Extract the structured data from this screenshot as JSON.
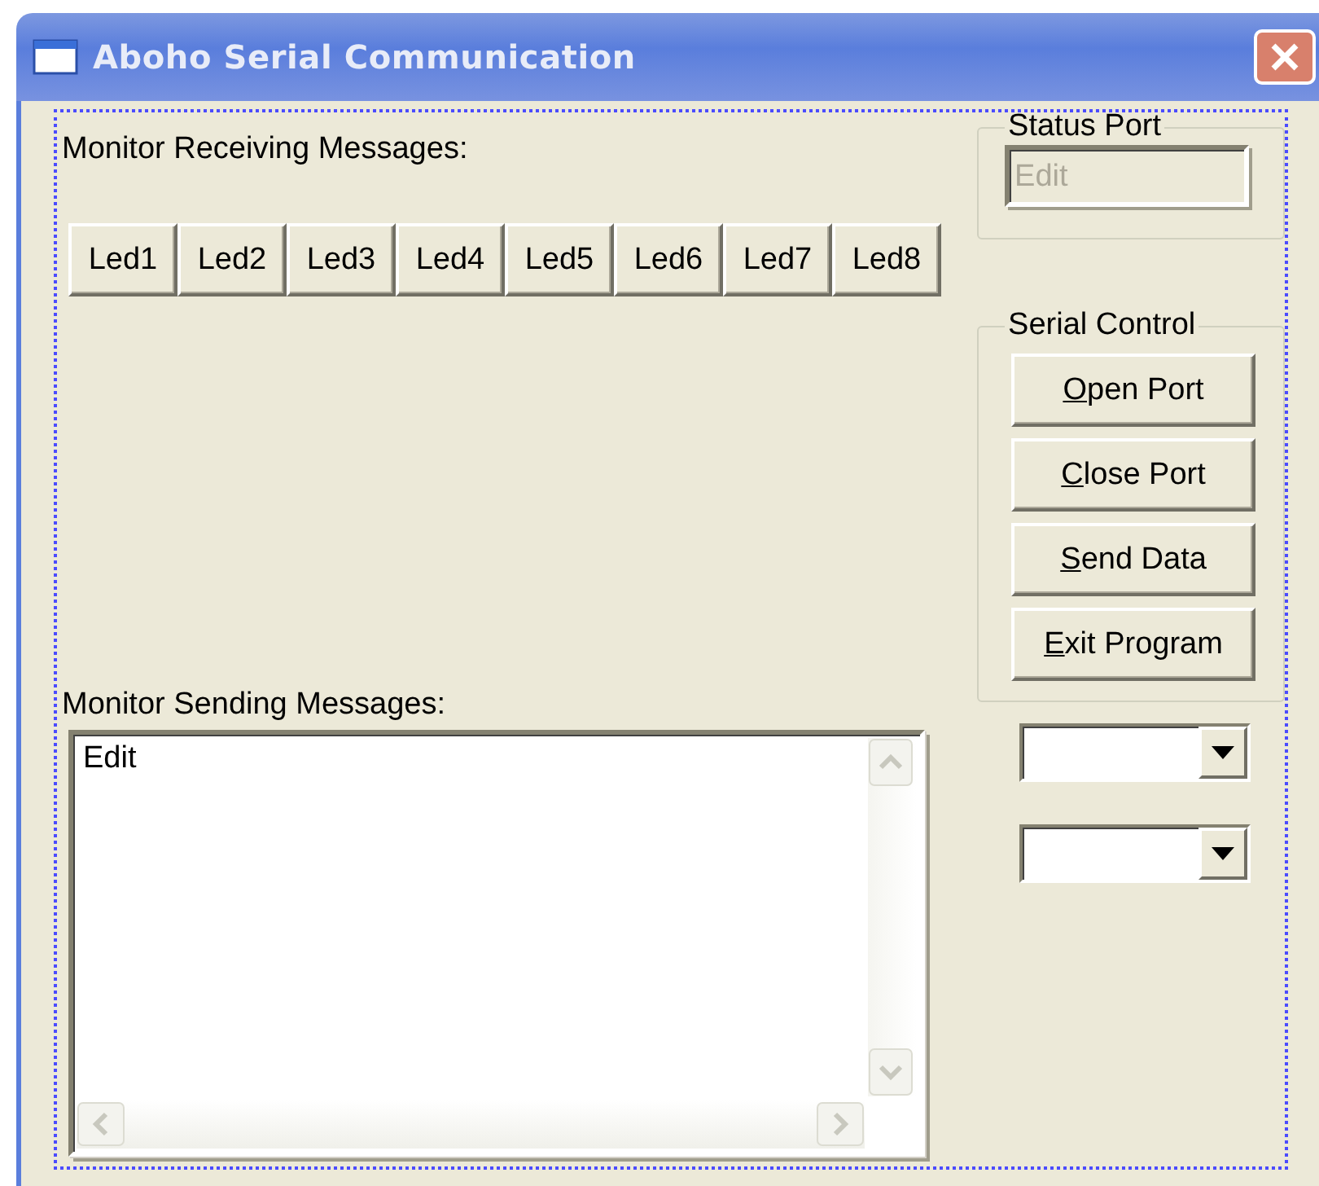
{
  "window": {
    "title": "Aboho Serial Communication"
  },
  "receive": {
    "label": "Monitor Receiving Messages:",
    "leds": [
      "Led1",
      "Led2",
      "Led3",
      "Led4",
      "Led5",
      "Led6",
      "Led7",
      "Led8"
    ]
  },
  "status_port": {
    "title": "Status Port",
    "field": {
      "value": "Edit",
      "disabled": true
    }
  },
  "serial_control": {
    "title": "Serial Control",
    "buttons": [
      {
        "label": "Open Port"
      },
      {
        "label": "Close Port"
      },
      {
        "label": "Send Data"
      },
      {
        "label": "Exit Program"
      }
    ]
  },
  "send": {
    "label": "Monitor Sending Messages:",
    "text": "Edit"
  }
}
